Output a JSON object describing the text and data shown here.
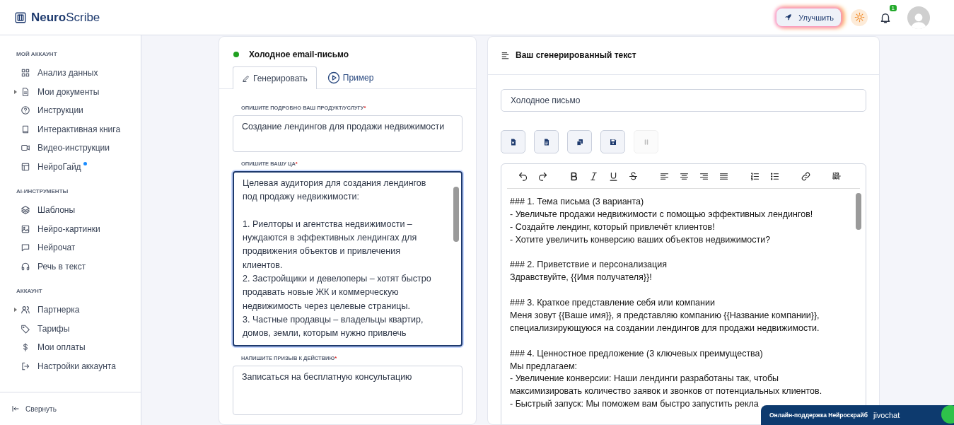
{
  "header": {
    "logo": "**Neuro**Scribe",
    "upgrade_button": "Улучшить",
    "notifications_badge": "1"
  },
  "sidebar": {
    "sections": [
      {
        "title": "МОЙ АККАУНТ",
        "items": [
          {
            "label": "Анализ данных",
            "expandable": false,
            "new_dot": false
          },
          {
            "label": "Мои документы",
            "expandable": true,
            "new_dot": false
          },
          {
            "label": "Инструкции",
            "expandable": false,
            "new_dot": false
          },
          {
            "label": "Интерактивная книга",
            "expandable": false,
            "new_dot": false
          },
          {
            "label": "Видео-инструкции",
            "expandable": false,
            "new_dot": false
          },
          {
            "label": "НейроГайд",
            "expandable": false,
            "new_dot": true
          }
        ]
      },
      {
        "title": "AI-ИНСТРУМЕНТЫ",
        "items": [
          {
            "label": "Шаблоны",
            "expandable": false,
            "new_dot": false
          },
          {
            "label": "Нейро-картинки",
            "expandable": false,
            "new_dot": false
          },
          {
            "label": "Нейрочат",
            "expandable": false,
            "new_dot": false
          },
          {
            "label": "Речь в текст",
            "expandable": false,
            "new_dot": false
          }
        ]
      },
      {
        "title": "АККАУНТ",
        "items": [
          {
            "label": "Партнерка",
            "expandable": true,
            "new_dot": false
          },
          {
            "label": "Тарифы",
            "expandable": false,
            "new_dot": false
          },
          {
            "label": "Мои оплаты",
            "expandable": false,
            "new_dot": false
          },
          {
            "label": "Настройки аккаунта",
            "expandable": false,
            "new_dot": false
          }
        ]
      }
    ],
    "collapse": "Свернуть"
  },
  "form_card": {
    "title": "Холодное email-письмо",
    "tabs": [
      {
        "label": "Генерировать",
        "selected": true
      },
      {
        "label": "Пример",
        "selected": false
      }
    ],
    "fields": [
      {
        "label": "ОПИШИТЕ ПОДРОБНО ВАШ ПРОДУКТ/УСЛУГУ",
        "required_mark": "*",
        "value": "Создание лендингов для продажи недвижимости",
        "focused": false
      },
      {
        "label": "ОПИШИТЕ ВАШУ ЦА",
        "required_mark": "*",
        "value": "Целевая аудитория для создания лендингов под продажу недвижимости:\n\n1. Риелторы и агентства недвижимости – нуждаются в эффективных лендингах для продвижения объектов и привлечения клиентов.\n2. Застройщики и девелоперы – хотят быстро продавать новые ЖК и коммерческую недвижимость через целевые страницы.\n3. Частные продавцы – владельцы квартир, домов, земли, которым нужно привлечь",
        "focused": true
      },
      {
        "label": "НАПИШИТЕ ПРИЗЫВ К ДЕЙСТВИЮ",
        "required_mark": "*",
        "value": "Записаться на бесплатную консультацию",
        "focused": false
      }
    ]
  },
  "result_card": {
    "title": "Ваш сгенерированный текст",
    "document_title": "Холодное письмо",
    "actions": [
      {
        "disabled": false
      },
      {
        "disabled": false
      },
      {
        "disabled": false
      },
      {
        "disabled": false
      },
      {
        "disabled": true
      }
    ],
    "editor_paragraphs": [
      {
        "lines": [
          "### 1. Тема письма (3 варианта)",
          "- Увеличьте продажи недвижимости с помощью эффективных лендингов!",
          "- Создайте лендинг, который привлечёт клиентов!",
          "- Хотите увеличить конверсию ваших объектов недвижимости?"
        ]
      },
      {
        "lines": [
          "### 2. Приветствие и персонализация",
          "Здравствуйте, {{Имя получателя}}!"
        ]
      },
      {
        "lines": [
          "### 3. Краткое представление себя или компании",
          "Меня зовут {{Ваше имя}}, я представляю компанию {{Название компании}},",
          "специализирующуюся на создании лендингов для продажи недвижимости."
        ]
      },
      {
        "lines": [
          "### 4. Ценностное предложение (3 ключевых преимущества)",
          "Мы предлагаем:",
          "- Увеличение конверсии: Наши лендинги разработаны так, чтобы",
          "максимизировать количество заявок и звонков от потенциальных клиентов.",
          "- Быстрый запуск: Мы поможем вам быстро запустить рекла"
        ]
      }
    ]
  },
  "chat_widget": {
    "label": "Онлайн-поддержка Нейроскрайб",
    "brand": "jivochat"
  }
}
